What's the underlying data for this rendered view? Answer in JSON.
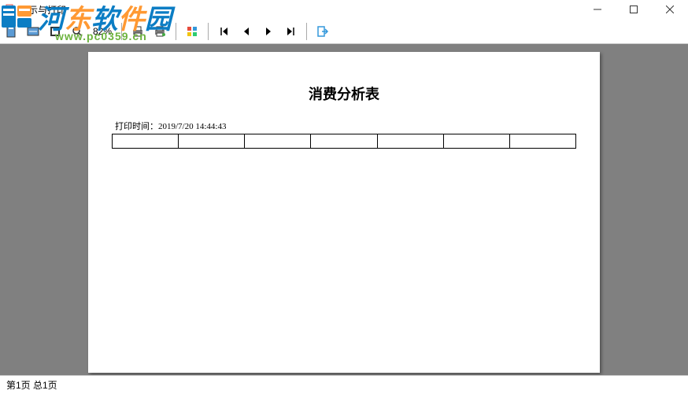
{
  "window": {
    "title": "显示与打印"
  },
  "toolbar": {
    "zoom": "82%"
  },
  "document": {
    "title": "消费分析表",
    "print_time_label": "打印时间：",
    "print_time_value": "2019/7/20 14:44:43"
  },
  "status": {
    "page_info": "第1页 总1页"
  },
  "watermark": {
    "text": "河东软件园",
    "url": "www.pc0359.cn"
  },
  "chart_data": {
    "type": "table",
    "title": "消费分析表",
    "columns": 7,
    "rows": 1,
    "data": [
      [
        "",
        "",
        "",
        "",
        "",
        "",
        ""
      ]
    ]
  }
}
